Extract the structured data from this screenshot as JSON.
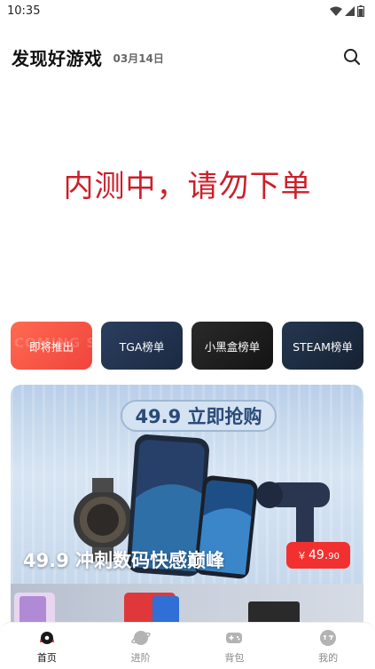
{
  "status_bar": {
    "time": "10:35"
  },
  "header": {
    "title": "发现好游戏",
    "date": "03月14日"
  },
  "notice": {
    "text": "内测中，请勿下单"
  },
  "rankings": [
    {
      "label": "即将推出",
      "watermark": "COMING SOON"
    },
    {
      "label": "TGA榜单"
    },
    {
      "label": "小黑盒榜单"
    },
    {
      "label": "STEAM榜单"
    }
  ],
  "banner": {
    "pill_text": "49.9 立即抢购",
    "headline": "49.9 冲刺数码快感巅峰",
    "price_currency": "￥",
    "price_integer": "49.",
    "price_decimal": "90"
  },
  "bottom_nav": [
    {
      "label": "首页",
      "active": true
    },
    {
      "label": "进阶"
    },
    {
      "label": "背包"
    },
    {
      "label": "我的"
    }
  ],
  "colors": {
    "accent_red": "#cc1f2a",
    "price_red": "#f23030",
    "brand_dark": "#1b2a42"
  },
  "icons": [
    "wifi-icon",
    "signal-icon",
    "battery-icon",
    "search-icon",
    "home-icon",
    "planet-icon",
    "gamepad-icon",
    "profile-icon"
  ]
}
